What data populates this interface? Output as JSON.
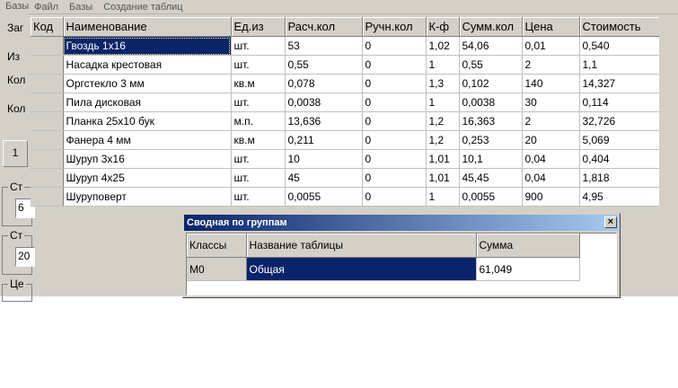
{
  "app": {
    "title_fragment": "Базы"
  },
  "menubar": {
    "items": [
      {
        "label": "Файл"
      },
      {
        "label": "Базы"
      },
      {
        "label": "Создание таблиц"
      }
    ]
  },
  "left_panel": {
    "labels": [
      "Заг",
      "Из",
      "Кол",
      "Кол"
    ],
    "button_label": "1",
    "groups": [
      {
        "title": "Ст",
        "value": "6"
      },
      {
        "title": "Ст",
        "value": "20"
      },
      {
        "title": "Це",
        "value": ""
      }
    ]
  },
  "main_grid": {
    "columns": [
      "Код",
      "Наименование",
      "Ед.из",
      "Расч.кол",
      "Ручн.кол",
      "К-ф",
      "Сумм.кол",
      "Цена",
      "Стоимость"
    ],
    "rows": [
      {
        "code": "",
        "name": "Гвоздь 1х16",
        "unit": "шт.",
        "calc": "53",
        "manual": "0",
        "k": "1,02",
        "sum": "54,06",
        "price": "0,01",
        "cost": "0,540"
      },
      {
        "code": "",
        "name": "Насадка крестовая",
        "unit": "шт.",
        "calc": "0,55",
        "manual": "0",
        "k": "1",
        "sum": "0,55",
        "price": "2",
        "cost": "1,1"
      },
      {
        "code": "",
        "name": "Оргстекло 3 мм",
        "unit": "кв.м",
        "calc": "0,078",
        "manual": "0",
        "k": "1,3",
        "sum": "0,102",
        "price": "140",
        "cost": "14,327"
      },
      {
        "code": "",
        "name": "Пила дисковая",
        "unit": "шт.",
        "calc": "0,0038",
        "manual": "0",
        "k": "1",
        "sum": "0,0038",
        "price": "30",
        "cost": "0,114"
      },
      {
        "code": "",
        "name": "Планка 25х10 бук",
        "unit": "м.п.",
        "calc": "13,636",
        "manual": "0",
        "k": "1,2",
        "sum": "16,363",
        "price": "2",
        "cost": "32,726"
      },
      {
        "code": "",
        "name": "Фанера 4 мм",
        "unit": "кв.м",
        "calc": "0,211",
        "manual": "0",
        "k": "1,2",
        "sum": "0,253",
        "price": "20",
        "cost": "5,069"
      },
      {
        "code": "",
        "name": "Шуруп 3х16",
        "unit": "шт.",
        "calc": "10",
        "manual": "0",
        "k": "1,01",
        "sum": "10,1",
        "price": "0,04",
        "cost": "0,404"
      },
      {
        "code": "",
        "name": "Шуруп 4х25",
        "unit": "шт.",
        "calc": "45",
        "manual": "0",
        "k": "1,01",
        "sum": "45,45",
        "price": "0,04",
        "cost": "1,818"
      },
      {
        "code": "",
        "name": "Шуруповерт",
        "unit": "шт.",
        "calc": "0,0055",
        "manual": "0",
        "k": "1",
        "sum": "0,0055",
        "price": "900",
        "cost": "4,95"
      }
    ]
  },
  "summary_dialog": {
    "title": "Сводная  по группам",
    "close_glyph": "×",
    "columns": [
      "Классы",
      "Название таблицы",
      "Сумма"
    ],
    "rows": [
      {
        "class": "М0",
        "table_name": "Общая",
        "sum": "61,049"
      }
    ]
  },
  "colors": {
    "selection": "#0a246a",
    "window_face": "#d4d0c8",
    "title_gradient_start": "#0a246a",
    "title_gradient_end": "#a6caf0"
  }
}
